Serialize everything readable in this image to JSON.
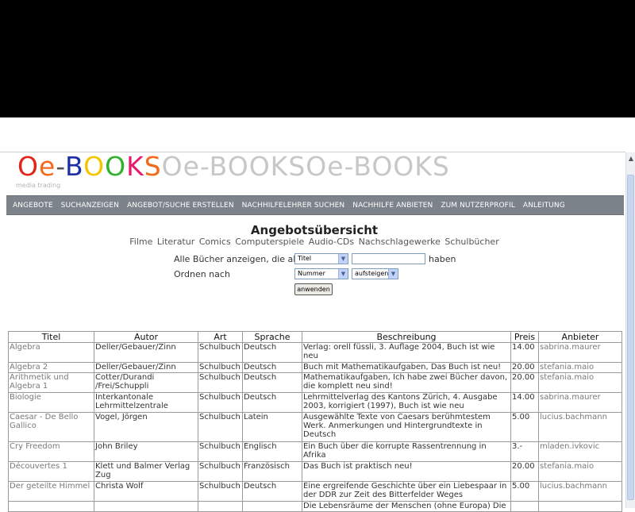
{
  "logo": {
    "letters": [
      {
        "ch": "O",
        "color": "#e2231a"
      },
      {
        "ch": "e",
        "color": "#f26a1b"
      },
      {
        "ch": "-",
        "color": "#555555"
      },
      {
        "ch": "B",
        "color": "#1f2fa8"
      },
      {
        "ch": "O",
        "color": "#f6c500"
      },
      {
        "ch": "O",
        "color": "#30b22d"
      },
      {
        "ch": "K",
        "color": "#e8196c"
      },
      {
        "ch": "S",
        "color": "#f26a1b"
      }
    ],
    "echo1": "Oe-BOOKS",
    "echo2": "Oe-BOOKS",
    "tagline": "media trading"
  },
  "nav": {
    "items": [
      "ANGEBOTE",
      "SUCHANZEIGEN",
      "ANGEBOT/SUCHE ERSTELLEN",
      "NACHHILFELEHRER SUCHEN",
      "NACHHILFE ANBIETEN",
      "ZUM NUTZERPROFIL",
      "ANLEITUNG"
    ]
  },
  "page": {
    "title": "Angebotsübersicht",
    "categories": [
      "Filme",
      "Literatur",
      "Comics",
      "Computerspiele",
      "Audio-CDs",
      "Nachschlagewerke",
      "Schulbücher"
    ]
  },
  "filter": {
    "show_label": "Alle Bücher anzeigen, die als",
    "field_select": "Titel",
    "search_value": "",
    "have_label": "haben",
    "order_label": "Ordnen nach",
    "order_select": "Nummer",
    "direction_select": "aufsteigend",
    "apply_label": "anwenden"
  },
  "table": {
    "headers": [
      "Titel",
      "Autor",
      "Art",
      "Sprache",
      "Beschreibung",
      "Preis",
      "Anbieter"
    ],
    "rows": [
      [
        "Algebra",
        "Deller/Gebauer/Zinn",
        "Schulbuch",
        "Deutsch",
        "Verlag: orell füssli, 3. Auflage 2004, Buch ist wie neu",
        "14.00",
        "sabrina.maurer"
      ],
      [
        "Algebra 2",
        "Deller/Gebauer/Zinn",
        "Schulbuch",
        "Deutsch",
        "Buch mit Mathematikaufgaben, Das Buch ist neu!",
        "20.00",
        "stefania.maio"
      ],
      [
        "Arithmetik und Algebra 1",
        "Cotter/Durandi /Frei/Schuppli",
        "Schulbuch",
        "Deutsch",
        "Mathematikaufgaben, Ich habe zwei Bücher davon, die komplett neu sind!",
        "20.00",
        "stefania.maio"
      ],
      [
        "Biologie",
        "Interkantonale Lehrmittelzentrale",
        "Schulbuch",
        "Deutsch",
        "Lehrmittelverlag des Kantons Zürich, 4. Ausgabe 2003, korrigiert (1997), Buch ist wie neu",
        "14.00",
        "sabrina.maurer"
      ],
      [
        "Caesar - De Bello Gallico",
        "Vogel, Jörgen",
        "Schulbuch",
        "Latein",
        "Ausgewählte Texte von Caesars berühmtestem Werk. Anmerkungen und Hintergrundtexte in Deutsch",
        "5.00",
        "lucius.bachmann"
      ],
      [
        "Cry Freedom",
        "John Briley",
        "Schulbuch",
        "Englisch",
        "Ein Buch über die korrupte Rassentrennung in Afrika",
        "3.-",
        "mladen.ivkovic"
      ],
      [
        "Découvertes 1",
        "Klett und Balmer Verlag Zug",
        "Schulbuch",
        "Französisch",
        "Das Buch ist praktisch neu!",
        "20.00",
        "stefania.maio"
      ],
      [
        "Der geteilte Himmel",
        "Christa Wolf",
        "Schulbuch",
        "Deutsch",
        "Eine ergreifende Geschichte über ein Liebespaar in der DDR zur Zeit des Bitterfelder Weges",
        "5.00",
        "lucius.bachmann"
      ],
      [
        "",
        "",
        "",
        "",
        "Die Lebensräume der Menschen (ohne Europa) Die",
        "",
        ""
      ]
    ]
  }
}
